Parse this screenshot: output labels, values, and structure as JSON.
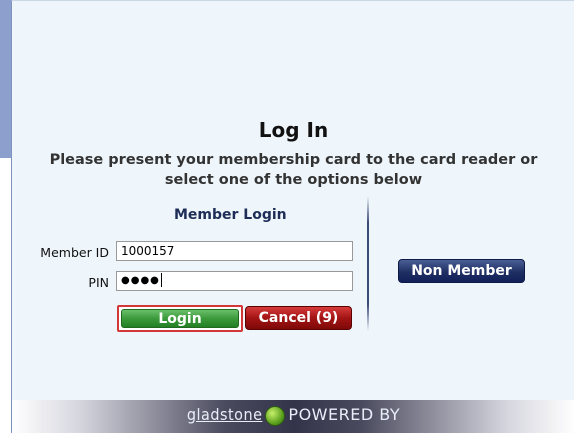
{
  "title": "Log In",
  "subtitle_line1": "Please present your membership card to the card reader or",
  "subtitle_line2": "select one of the options below",
  "member_login": {
    "heading": "Member Login",
    "member_id_label": "Member ID",
    "member_id_value": "1000157",
    "pin_label": "PIN",
    "pin_value": "●●●●"
  },
  "buttons": {
    "login": "Login",
    "cancel": "Cancel (9)",
    "non_member": "Non Member"
  },
  "footer": {
    "brand": "gladstone",
    "logo_icon": "globe-icon",
    "powered_by": "POWERED BY"
  },
  "colors": {
    "panel_bg": "#eef6fb",
    "login_green": "#3b9a3b",
    "cancel_red": "#a31414",
    "non_member_navy": "#1f2f63"
  }
}
